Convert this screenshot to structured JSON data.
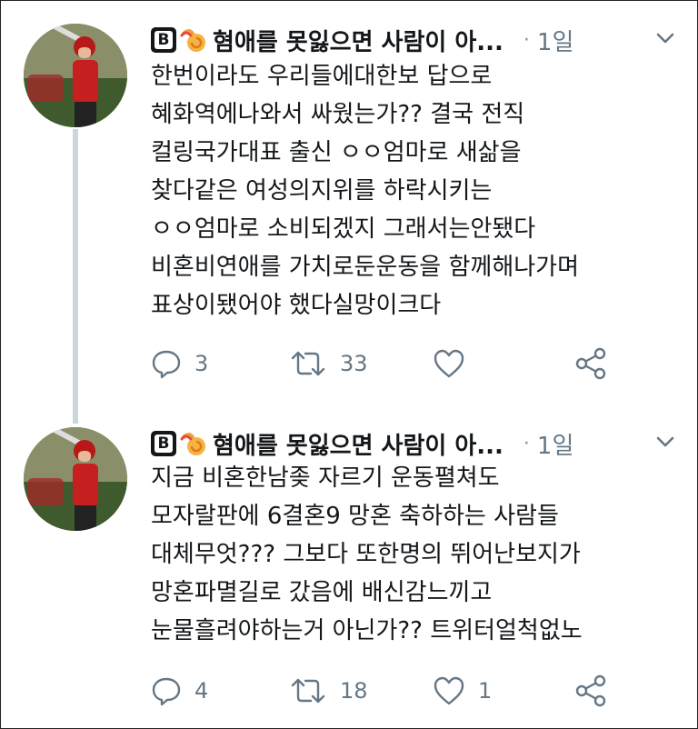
{
  "tweets": [
    {
      "badge": "B",
      "name": "혐애를 못잃으면 사람이 아...",
      "separator": "·",
      "time": "1일",
      "lines": [
        "한번이라도 우리들에대한보 답으로",
        "혜화역에나와서 싸웠는가?? 결국 전직",
        "컬링국가대표 출신 ㅇㅇ엄마로 새삶을",
        "찾다같은 여성의지위를 하락시키는",
        "ㅇㅇ엄마로 소비되겠지 그래서는안됐다",
        "비혼비연애를 가치로둔운동을 함께해나가며",
        "표상이됐어야 했다실망이크다"
      ],
      "replies": "3",
      "retweets": "33",
      "likes": "",
      "icons": [
        "reply-icon",
        "retweet-icon",
        "heart-icon",
        "share-icon"
      ]
    },
    {
      "badge": "B",
      "name": "혐애를 못잃으면 사람이 아...",
      "separator": "·",
      "time": "1일",
      "lines": [
        "지금 비혼한남좆 자르기 운동펼쳐도",
        "모자랄판에 6결혼9 망혼 축하하는 사람들",
        "대체무엇??? 그보다 또한명의 뛰어난보지가",
        "망혼파멸길로 갔음에 배신감느끼고",
        "눈물흘려야하는거 아닌가?? 트위터얼척없노"
      ],
      "replies": "4",
      "retweets": "18",
      "likes": "1",
      "icons": [
        "reply-icon",
        "retweet-icon",
        "heart-icon",
        "share-icon"
      ]
    }
  ],
  "colors": {
    "text": "#14171a",
    "muted": "#657786",
    "thread_line": "#ccd6dd",
    "icon": "#657786"
  }
}
